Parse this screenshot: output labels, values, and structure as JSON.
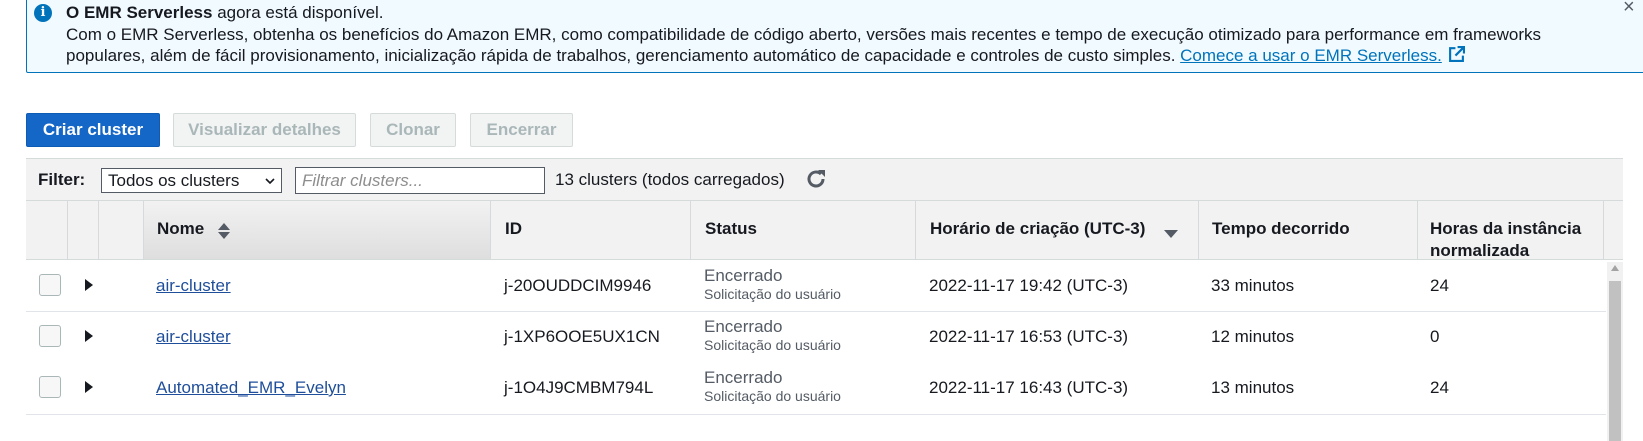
{
  "banner": {
    "title_bold": "O EMR Serverless",
    "title_rest": " agora está disponível.",
    "body": "Com o EMR Serverless, obtenha os benefícios do Amazon EMR, como compatibilidade de código aberto, versões mais recentes e tempo de execução otimizado para performance em frameworks populares, além de fácil provisionamento, inicialização rápida de trabalhos, gerenciamento automático de capacidade e controles de custo simples. ",
    "link": "Comece a usar o EMR Serverless.",
    "close": "×",
    "info_glyph": "i"
  },
  "toolbar": {
    "create_label": "Criar cluster",
    "view_label": "Visualizar detalhes",
    "clone_label": "Clonar",
    "end_label": "Encerrar"
  },
  "filter": {
    "label": "Filter:",
    "select_value": "Todos os clusters",
    "placeholder": "Filtrar clusters...",
    "count_text": "13 clusters (todos carregados)"
  },
  "table": {
    "columns": {
      "name": "Nome",
      "id": "ID",
      "status": "Status",
      "created": "Horário de criação (UTC-3)",
      "elapsed": "Tempo decorrido",
      "hours_line1": "Horas da instância",
      "hours_line2": "normalizada"
    },
    "rows": [
      {
        "name": "air-cluster",
        "id": "j-20OUDDCIM9946",
        "status": "Encerrado",
        "status_detail": "Solicitação do usuário",
        "created": "2022-11-17 19:42 (UTC-3)",
        "elapsed": "33 minutos",
        "hours": "24"
      },
      {
        "name": "air-cluster",
        "id": "j-1XP6OOE5UX1CN",
        "status": "Encerrado",
        "status_detail": "Solicitação do usuário",
        "created": "2022-11-17 16:53 (UTC-3)",
        "elapsed": "12 minutos",
        "hours": "0"
      },
      {
        "name": "Automated_EMR_Evelyn",
        "id": "j-1O4J9CMBM794L",
        "status": "Encerrado",
        "status_detail": "Solicitação do usuário",
        "created": "2022-11-17 16:43 (UTC-3)",
        "elapsed": "13 minutos",
        "hours": "24"
      }
    ]
  },
  "colors": {
    "primary": "#1466c7",
    "banner_border": "#0073bb",
    "banner_bg": "#f1faff",
    "link": "#1f4e9a"
  }
}
